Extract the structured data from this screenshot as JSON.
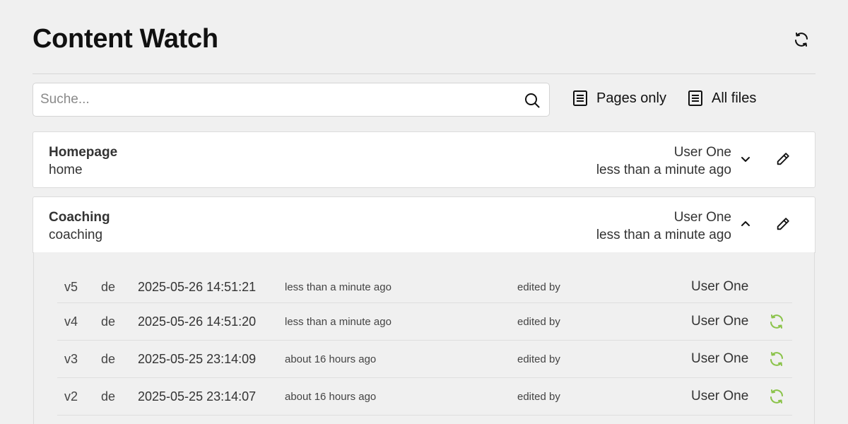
{
  "header": {
    "title": "Content Watch",
    "refresh_icon": "refresh-icon"
  },
  "search": {
    "placeholder": "Suche...",
    "value": ""
  },
  "filters": [
    {
      "label": "Pages only",
      "icon": "document-icon"
    },
    {
      "label": "All files",
      "icon": "document-icon"
    }
  ],
  "pages": [
    {
      "name": "Homepage",
      "slug": "home",
      "user": "User One",
      "time": "less than a minute ago",
      "expanded": false
    },
    {
      "name": "Coaching",
      "slug": "coaching",
      "user": "User One",
      "time": "less than a minute ago",
      "expanded": true,
      "versions": [
        {
          "version": "v5",
          "lang": "de",
          "datetime": "2025-05-26 14:51:21",
          "relative": "less than a minute ago",
          "edited_label": "edited by",
          "user": "User One",
          "restorable": false
        },
        {
          "version": "v4",
          "lang": "de",
          "datetime": "2025-05-26 14:51:20",
          "relative": "less than a minute ago",
          "edited_label": "edited by",
          "user": "User One",
          "restorable": true
        },
        {
          "version": "v3",
          "lang": "de",
          "datetime": "2025-05-25 23:14:09",
          "relative": "about 16 hours ago",
          "edited_label": "edited by",
          "user": "User One",
          "restorable": true
        },
        {
          "version": "v2",
          "lang": "de",
          "datetime": "2025-05-25 23:14:07",
          "relative": "about 16 hours ago",
          "edited_label": "edited by",
          "user": "User One",
          "restorable": true
        }
      ]
    }
  ],
  "colors": {
    "restore_icon": "#8bc34a",
    "background": "#f0f0f0"
  }
}
